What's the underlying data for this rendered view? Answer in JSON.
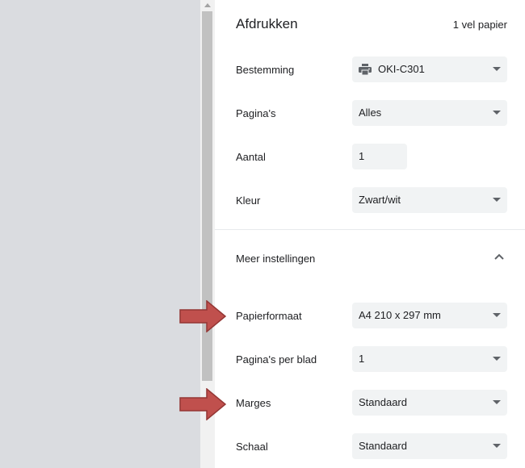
{
  "header": {
    "title": "Afdrukken",
    "sheets": "1 vel papier"
  },
  "settings": {
    "destination": {
      "label": "Bestemming",
      "value": "OKI-C301",
      "icon": "printer-icon"
    },
    "pages": {
      "label": "Pagina's",
      "value": "Alles"
    },
    "copies": {
      "label": "Aantal",
      "value": "1"
    },
    "color": {
      "label": "Kleur",
      "value": "Zwart/wit"
    }
  },
  "more_settings": {
    "label": "Meer instellingen",
    "icon": "chevron-up-icon"
  },
  "advanced": {
    "paper_size": {
      "label": "Papierformaat",
      "value": "A4 210 x 297 mm"
    },
    "pages_per_sheet": {
      "label": "Pagina's per blad",
      "value": "1"
    },
    "margins": {
      "label": "Marges",
      "value": "Standaard"
    },
    "scale": {
      "label": "Schaal",
      "value": "Standaard"
    }
  },
  "annotations": {
    "arrow_color": "#c0504d",
    "arrow_border": "#943634"
  }
}
